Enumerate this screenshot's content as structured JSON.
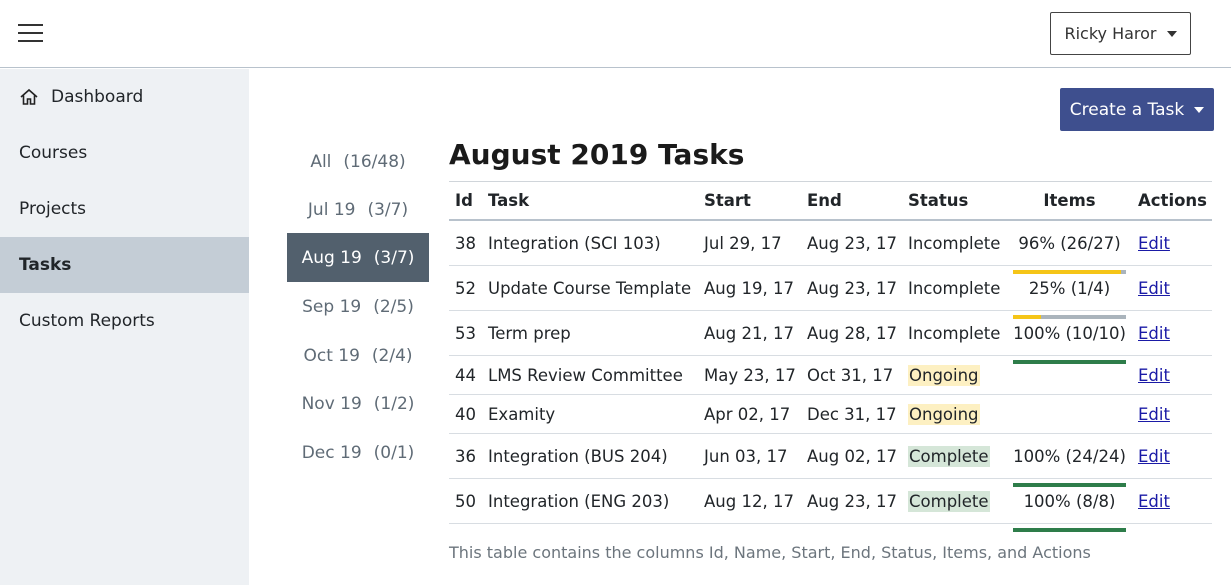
{
  "header": {
    "user_name": "Ricky Haror"
  },
  "sidebar": {
    "items": [
      {
        "label": "Dashboard",
        "icon": "home-icon"
      },
      {
        "label": "Courses"
      },
      {
        "label": "Projects"
      },
      {
        "label": "Tasks",
        "active": true
      },
      {
        "label": "Custom Reports"
      }
    ]
  },
  "months": [
    {
      "label": "All",
      "count": "(16/48)"
    },
    {
      "label": "Jul 19",
      "count": "(3/7)"
    },
    {
      "label": "Aug 19",
      "count": "(3/7)",
      "active": true
    },
    {
      "label": "Sep 19",
      "count": "(2/5)"
    },
    {
      "label": "Oct 19",
      "count": "(2/4)"
    },
    {
      "label": "Nov 19",
      "count": "(1/2)"
    },
    {
      "label": "Dec 19",
      "count": "(0/1)"
    }
  ],
  "main": {
    "create_label": "Create a Task",
    "title": "August 2019 Tasks",
    "caption": "This table contains the columns Id, Name, Start, End, Status, Items, and Actions"
  },
  "table": {
    "headers": [
      "Id",
      "Task",
      "Start",
      "End",
      "Status",
      "Items",
      "Actions"
    ],
    "rows": [
      {
        "id": "38",
        "task": "Integration (SCI 103)",
        "start": "Jul 29, 17",
        "end": "Aug 23, 17",
        "status": "Incomplete",
        "items": "96% (26/27)",
        "progress": 0.96,
        "bar_color": "#f5c518",
        "action": "Edit"
      },
      {
        "id": "52",
        "task": "Update Course Template",
        "start": "Aug 19, 17",
        "end": "Aug 23, 17",
        "status": "Incomplete",
        "items": "25% (1/4)",
        "progress": 0.25,
        "bar_color": "#f5c518",
        "action": "Edit"
      },
      {
        "id": "53",
        "task": "Term prep",
        "start": "Aug 21, 17",
        "end": "Aug 28, 17",
        "status": "Incomplete",
        "items": "100% (10/10)",
        "progress": 1.0,
        "bar_color": "#2e7d4a",
        "action": "Edit"
      },
      {
        "id": "44",
        "task": "LMS Review Committee",
        "start": "May 23, 17",
        "end": "Oct 31, 17",
        "status": "Ongoing",
        "items": "",
        "action": "Edit"
      },
      {
        "id": "40",
        "task": "Examity",
        "start": "Apr 02, 17",
        "end": "Dec 31, 17",
        "status": "Ongoing",
        "items": "",
        "action": "Edit"
      },
      {
        "id": "36",
        "task": "Integration (BUS 204)",
        "start": "Jun 03, 17",
        "end": "Aug 02, 17",
        "status": "Complete",
        "items": "100% (24/24)",
        "progress": 1.0,
        "bar_color": "#2e7d4a",
        "action": "Edit"
      },
      {
        "id": "50",
        "task": "Integration (ENG 203)",
        "start": "Aug 12, 17",
        "end": "Aug 23, 17",
        "status": "Complete",
        "items": "100% (8/8)",
        "progress": 1.0,
        "bar_color": "#2e7d4a",
        "action": "Edit"
      }
    ]
  }
}
